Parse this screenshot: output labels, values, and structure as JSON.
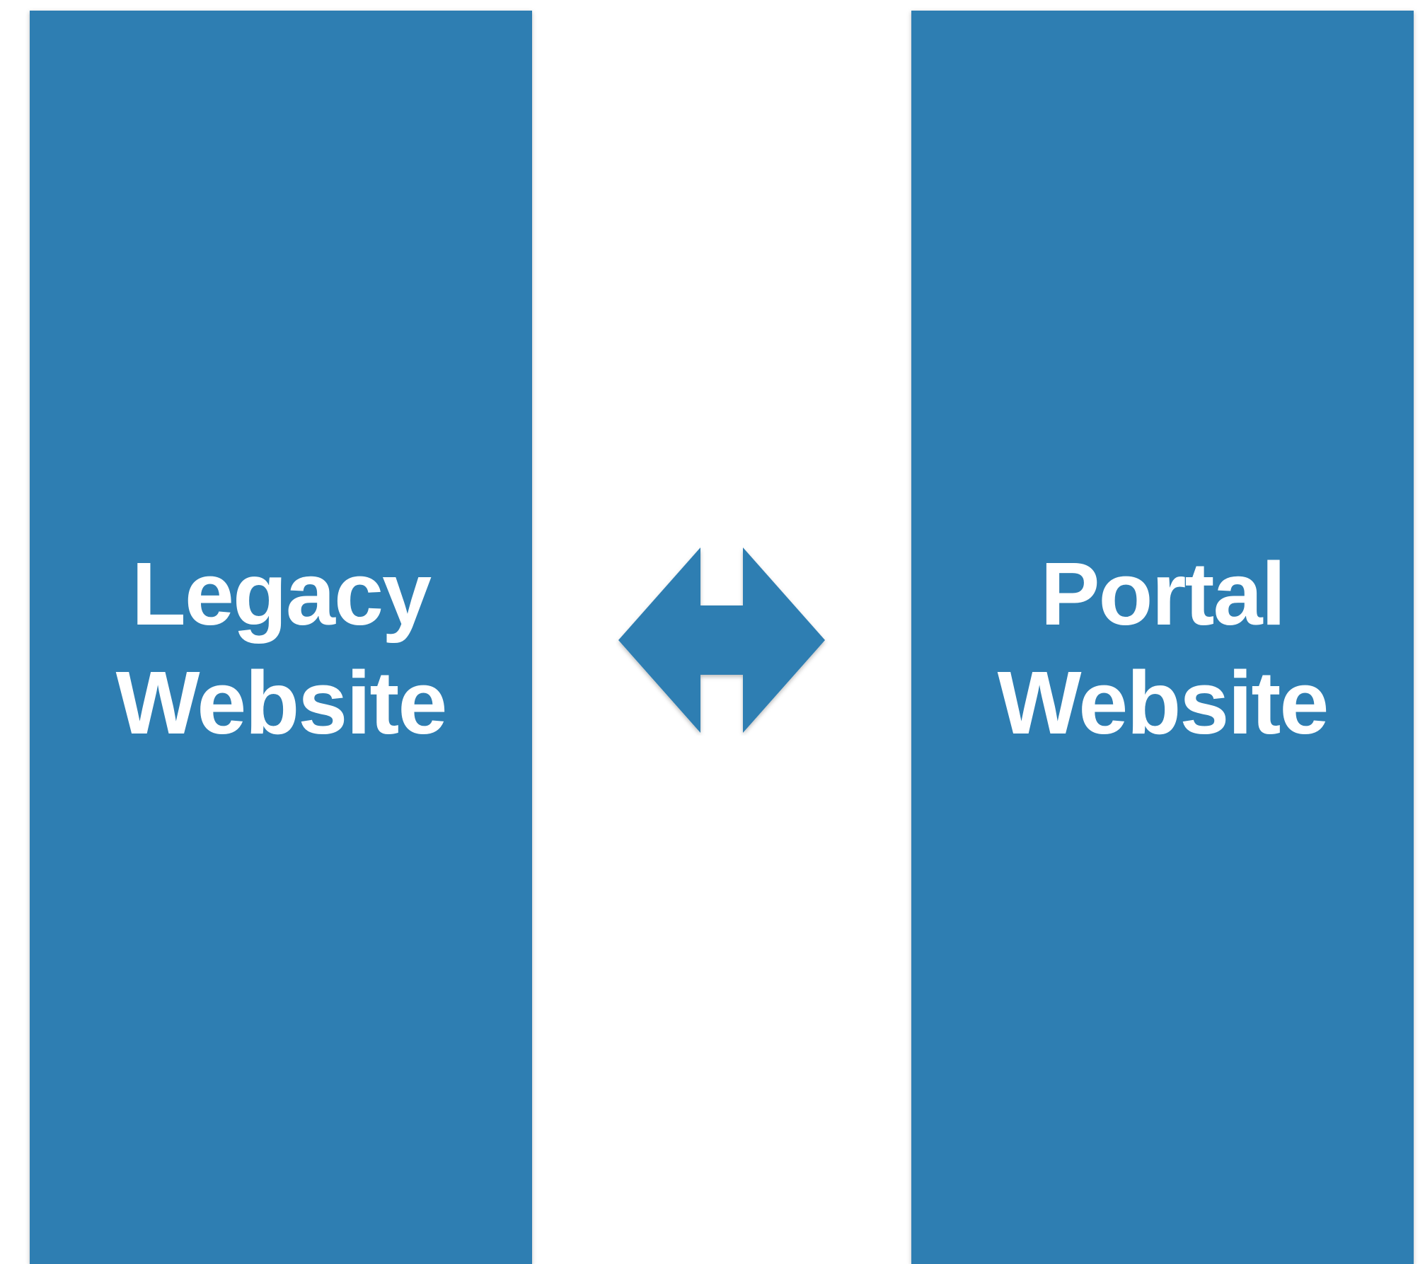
{
  "left_panel": {
    "line1": "Legacy",
    "line2": "Website"
  },
  "right_panel": {
    "line1": "Portal",
    "line2": "Website"
  },
  "connector": {
    "icon": "bidirectional-arrow-icon"
  },
  "colors": {
    "panel": "#2e7eb2",
    "text": "#ffffff",
    "background": "#ffffff"
  }
}
